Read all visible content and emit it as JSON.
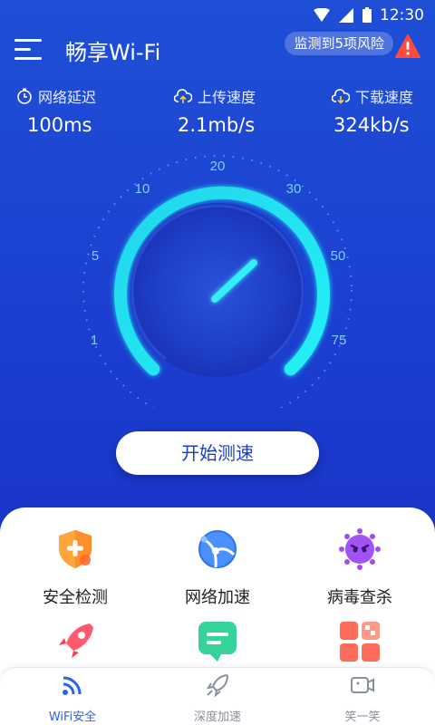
{
  "status_bar": {
    "time": "12:30"
  },
  "header": {
    "title": "畅享Wi-Fi",
    "risk_text": "监测到5项风险"
  },
  "stats": {
    "latency": {
      "label": "网络延迟",
      "value": "100ms"
    },
    "upload": {
      "label": "上传速度",
      "value": "2.1mb/s"
    },
    "download": {
      "label": "下载速度",
      "value": "324kb/s"
    }
  },
  "gauge": {
    "scale_labels": [
      "1",
      "5",
      "10",
      "20",
      "30",
      "50",
      "75"
    ]
  },
  "start_button": {
    "label": "开始测速"
  },
  "features": [
    {
      "label": "安全检测",
      "icon": "shield-plus-icon"
    },
    {
      "label": "网络加速",
      "icon": "globe-network-icon"
    },
    {
      "label": "病毒查杀",
      "icon": "virus-icon"
    },
    {
      "label": "",
      "icon": "rocket-icon"
    },
    {
      "label": "",
      "icon": "message-icon"
    },
    {
      "label": "",
      "icon": "grid-apps-icon"
    }
  ],
  "tabs": [
    {
      "label": "WiFi安全",
      "icon": "wifi-signal-icon",
      "active": true
    },
    {
      "label": "深度加速",
      "icon": "rocket-outline-icon",
      "active": false
    },
    {
      "label": "笑一笑",
      "icon": "video-icon",
      "active": false
    }
  ],
  "colors": {
    "background": "#1c3fcd",
    "gauge_arc": "#22e3f2",
    "accent": "#2b62e8",
    "warning": "#ff4a3d"
  }
}
